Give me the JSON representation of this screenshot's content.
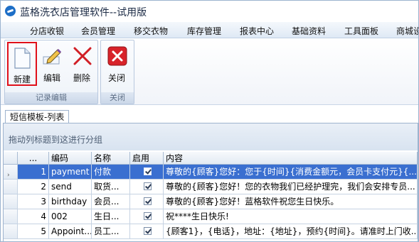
{
  "window": {
    "title": "蓝格洗衣店管理软件--试用版"
  },
  "menu": [
    "分店收银",
    "会员管理",
    "移交衣物",
    "库存管理",
    "报表中心",
    "基础资料",
    "工具面板",
    "商城设"
  ],
  "ribbon": {
    "record_group": {
      "caption": "记录编辑",
      "new_label": "新建",
      "edit_label": "编辑",
      "delete_label": "删除"
    },
    "close_group": {
      "caption": "关闭",
      "close_label": "关闭"
    }
  },
  "tab": {
    "label": "短信模板-列表"
  },
  "grid": {
    "group_hint": "拖动列标题到这进行分组",
    "columns": [
      "...",
      "编码",
      "名称",
      "启用",
      "内容"
    ],
    "rows": [
      {
        "index": "1",
        "code": "payment",
        "name": "付款",
        "enabled": true,
        "content": "尊敬的{顾客}您好：您于{时间}{消费金额元，会员卡支付元}{..."
      },
      {
        "index": "2",
        "code": "send",
        "name": "取货...",
        "enabled": true,
        "content": "尊敬的{顾客}您好！您的衣物我们已经护理完，我们会安排专员..."
      },
      {
        "index": "3",
        "code": "birthday",
        "name": "会员...",
        "enabled": true,
        "content": "尊敬的{顾客}您好！蓝格软件祝您生日快乐。"
      },
      {
        "index": "4",
        "code": "002",
        "name": "生日...",
        "enabled": true,
        "content": "祝****生日快乐!"
      },
      {
        "index": "5",
        "code": "Appoint...",
        "name": "员工...",
        "enabled": true,
        "content": "{顾客1}，{电话}，地址：{地址}，预约{时间}。请准时上门收..."
      }
    ],
    "selected_row": 0
  },
  "colors": {
    "selection": "#3a6fd0",
    "highlight_border": "#e0101a",
    "delete_icon": "#d11f26",
    "close_icon": "#d8232a"
  }
}
